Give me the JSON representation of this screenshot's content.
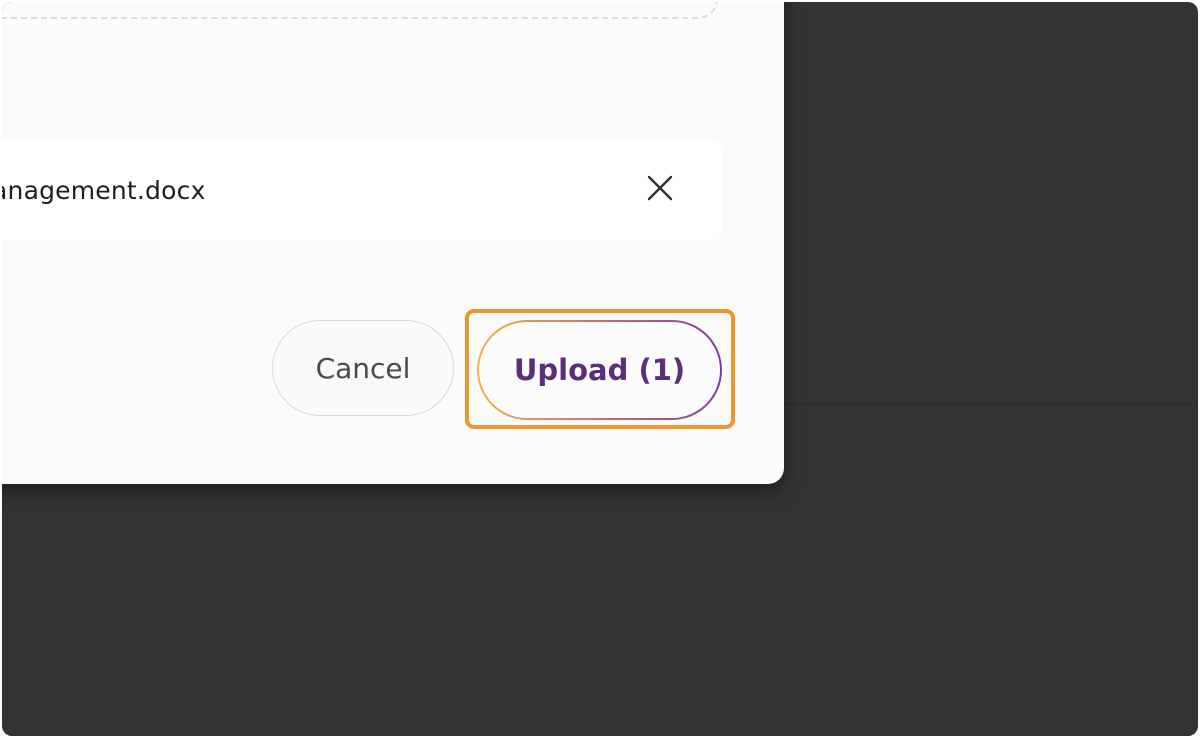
{
  "file": {
    "name": "anagement.docx",
    "remove_icon": "close-icon"
  },
  "actions": {
    "cancel_label": "Cancel",
    "upload_label": "Upload (1)"
  },
  "colors": {
    "backdrop": "#333333",
    "dialog": "#fbfbfb",
    "highlight": "#f0962f",
    "upload_text": "#5b2d7a",
    "upload_gradient_start": "#f2b24a",
    "upload_gradient_end": "#7c3f96"
  }
}
